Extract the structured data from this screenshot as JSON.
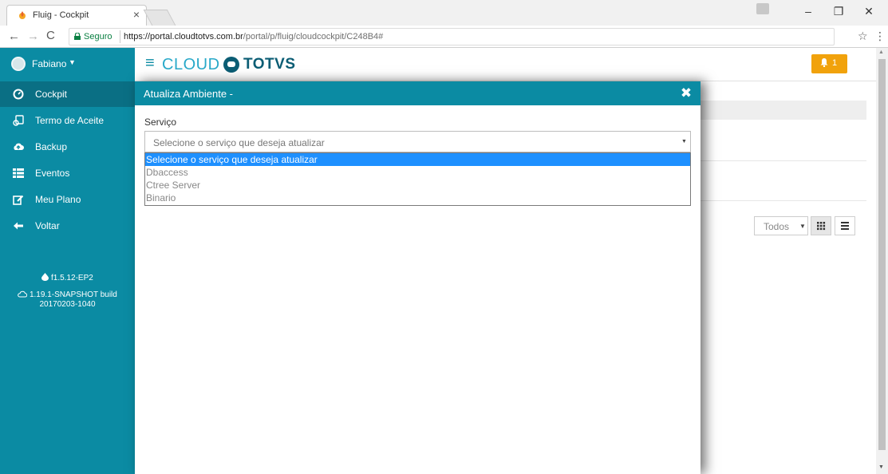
{
  "browser": {
    "tab_title": "Fluig - Cockpit",
    "tab_close": "×",
    "secure_label": "Seguro",
    "url_host": "https://portal.cloudtotvs.com.br",
    "url_path": "/portal/p/fluig/cloudcockpit/C248B4#",
    "icons": [
      "back-icon",
      "forward-icon",
      "reload-icon",
      "lock-icon",
      "star-icon",
      "menu-icon"
    ]
  },
  "header": {
    "user_name": "Fabiano",
    "brand_cloud": "CLOUD",
    "brand_totvs": "TOTVS",
    "notification_count": "1",
    "accent_color": "#0b8ba3",
    "notification_color": "#f1a20c"
  },
  "sidebar": {
    "items": [
      {
        "label": "Cockpit",
        "icon": "dashboard-icon",
        "active": true
      },
      {
        "label": "Termo de Aceite",
        "icon": "acceptance-icon",
        "active": false
      },
      {
        "label": "Backup",
        "icon": "cloud-upload-icon",
        "active": false
      },
      {
        "label": "Eventos",
        "icon": "list-icon",
        "active": false
      },
      {
        "label": "Meu Plano",
        "icon": "edit-icon",
        "active": false
      },
      {
        "label": "Voltar",
        "icon": "arrow-left-icon",
        "active": false
      }
    ],
    "fluig_version": "f1.5.12-EP2",
    "build_version": "1.19.1-SNAPSHOT build",
    "build_date": "20170203-1040"
  },
  "page": {
    "filter_value": "Todos"
  },
  "modal": {
    "title": "Atualiza Ambiente -",
    "field_label": "Serviço",
    "select_value": "Selecione o serviço que deseja atualizar",
    "options": [
      {
        "label": "Selecione o serviço que deseja atualizar",
        "selected": true
      },
      {
        "label": "Dbaccess",
        "selected": false
      },
      {
        "label": "Ctree Server",
        "selected": false
      },
      {
        "label": "Binario",
        "selected": false
      }
    ]
  }
}
